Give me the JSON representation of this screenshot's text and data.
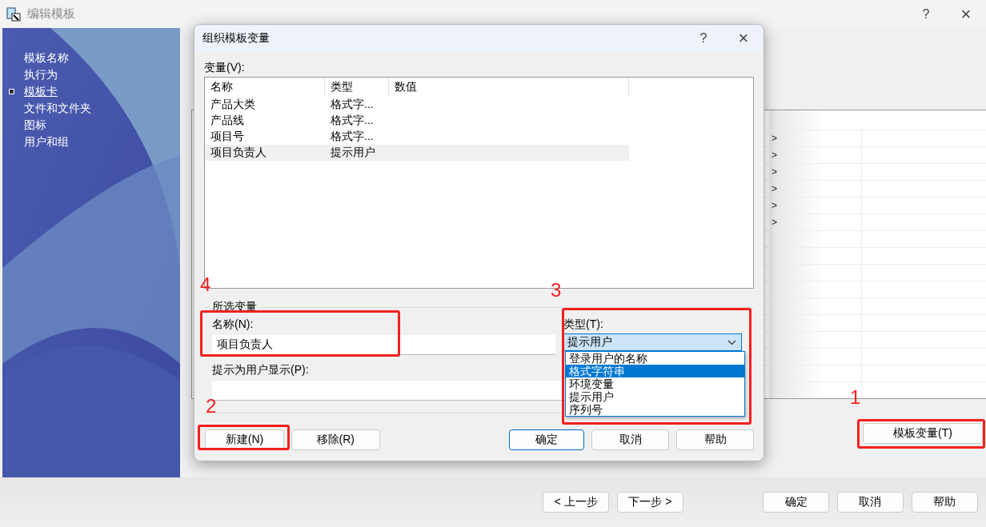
{
  "window": {
    "title": "编辑模板",
    "help": "?",
    "close": "×"
  },
  "sidebar": {
    "items": [
      {
        "label": "模板名称",
        "selected": false
      },
      {
        "label": "执行为",
        "selected": false
      },
      {
        "label": "模板卡",
        "selected": true
      },
      {
        "label": "文件和文件夹",
        "selected": false
      },
      {
        "label": "图标",
        "selected": false
      },
      {
        "label": "用户和组",
        "selected": false
      }
    ]
  },
  "content": {
    "table_rows": [
      {
        "column_1": ">"
      },
      {
        "column_1": ">"
      },
      {
        "column_1": ">"
      },
      {
        "column_1": ">"
      },
      {
        "column_1": ">"
      },
      {
        "column_1": ">"
      }
    ],
    "template_variables_button": "模板变量(T)"
  },
  "footer": {
    "buttons": [
      "< 上一步",
      "下一步 >",
      "确定",
      "取消",
      "帮助"
    ]
  },
  "dialog": {
    "title": "组织模板变量",
    "help": "?",
    "close": "×",
    "variables_label": "变量(V):",
    "columns": [
      "名称",
      "类型",
      "数值"
    ],
    "rows": [
      {
        "name": "产品大类",
        "type": "格式字...",
        "selected": false
      },
      {
        "name": "产品线",
        "type": "格式字...",
        "selected": false
      },
      {
        "name": "项目号",
        "type": "格式字...",
        "selected": false
      },
      {
        "name": "项目负责人",
        "type": "提示用户",
        "selected": true
      }
    ],
    "group_label": "所选变量",
    "name_label": "名称(N):",
    "name_value": "项目负责人",
    "type_label": "类型(T):",
    "type_value": "提示用户",
    "type_options": [
      {
        "label": "登录用户的名称",
        "selected": false
      },
      {
        "label": "格式字符串",
        "selected": true
      },
      {
        "label": "环境变量",
        "selected": false
      },
      {
        "label": "提示用户",
        "selected": false
      },
      {
        "label": "序列号",
        "selected": false
      }
    ],
    "prompt_label": "提示为用户显示(P):",
    "buttons": [
      {
        "label": "新建(N)",
        "default": false
      },
      {
        "label": "移除(R)",
        "default": false
      },
      {
        "label": "确定",
        "default": true
      },
      {
        "label": "取消",
        "default": false
      },
      {
        "label": "帮助",
        "default": false
      }
    ]
  },
  "annotations": [
    {
      "label": "4"
    },
    {
      "label": "3"
    },
    {
      "label": "2"
    },
    {
      "label": "1"
    }
  ]
}
